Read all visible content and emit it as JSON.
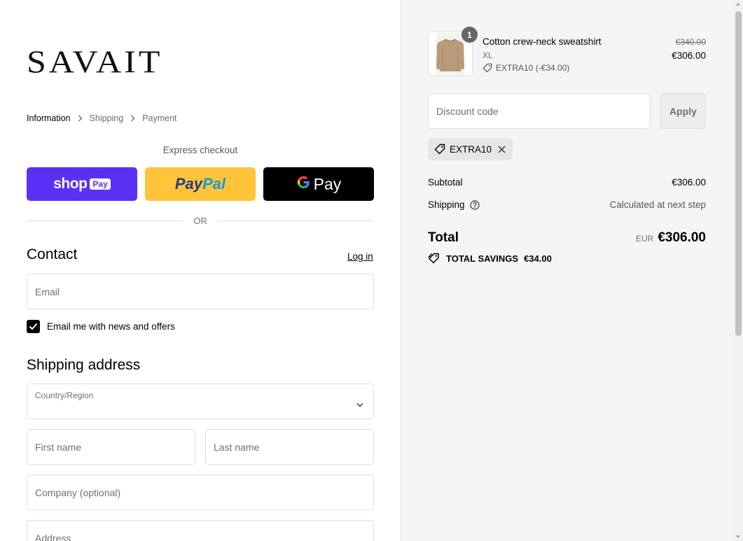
{
  "brand": {
    "logo_text": "SAVAIT"
  },
  "breadcrumb": [
    {
      "label": "Information",
      "active": true
    },
    {
      "label": "Shipping",
      "active": false
    },
    {
      "label": "Payment",
      "active": false
    }
  ],
  "express": {
    "title": "Express checkout",
    "shop_label": "shop",
    "shop_pay_badge": "Pay",
    "paypal_part1": "Pay",
    "paypal_part2": "Pal",
    "gpay_label": "Pay",
    "or_label": "OR"
  },
  "contact": {
    "title": "Contact",
    "login_label": "Log in",
    "email_placeholder": "Email",
    "newsletter_label": "Email me with news and offers",
    "newsletter_checked": true
  },
  "shipping_address": {
    "title": "Shipping address",
    "country_label": "Country/Region",
    "first_name_placeholder": "First name",
    "last_name_placeholder": "Last name",
    "company_placeholder": "Company (optional)",
    "address_placeholder": "Address"
  },
  "order": {
    "item": {
      "name": "Cotton crew-neck sweatshirt",
      "variant": "XL",
      "quantity": "1",
      "discount": "EXTRA10 (-€34.00)",
      "original_price": "€340.00",
      "price": "€306.00"
    },
    "discount_placeholder": "Discount code",
    "apply_label": "Apply",
    "applied_code": "EXTRA10",
    "subtotal_label": "Subtotal",
    "subtotal_value": "€306.00",
    "shipping_label": "Shipping",
    "shipping_value": "Calculated at next step",
    "total_label": "Total",
    "total_currency": "EUR",
    "total_value": "€306.00",
    "savings_label": "TOTAL SAVINGS",
    "savings_value": "€34.00"
  },
  "colors": {
    "shop_pay": "#5a31f4",
    "paypal": "#ffc439",
    "gpay": "#000000",
    "summary_bg": "#f5f5f5"
  }
}
